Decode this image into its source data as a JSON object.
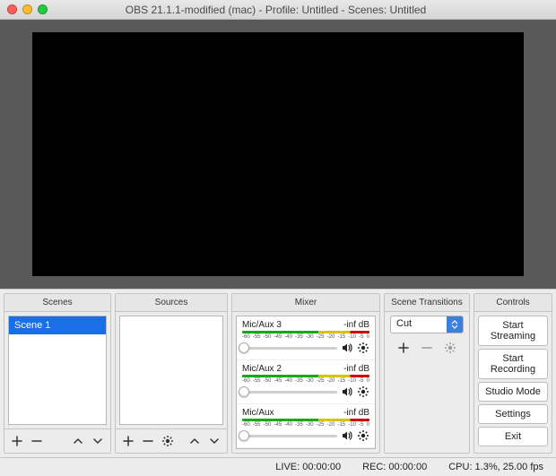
{
  "titlebar": {
    "title": "OBS 21.1.1-modified (mac) - Profile: Untitled - Scenes: Untitled"
  },
  "panels": {
    "scenes": {
      "header": "Scenes",
      "items": [
        "Scene 1"
      ]
    },
    "sources": {
      "header": "Sources"
    },
    "mixer": {
      "header": "Mixer",
      "ticks": [
        "-60",
        "-55",
        "-50",
        "-45",
        "-40",
        "-35",
        "-30",
        "-25",
        "-20",
        "-15",
        "-10",
        "-5",
        "0"
      ],
      "channels": [
        {
          "name": "Mic/Aux 3",
          "level": "-inf dB"
        },
        {
          "name": "Mic/Aux 2",
          "level": "-inf dB"
        },
        {
          "name": "Mic/Aux",
          "level": "-inf dB"
        }
      ]
    },
    "transitions": {
      "header": "Scene Transitions",
      "selected": "Cut"
    },
    "controls": {
      "header": "Controls",
      "buttons": {
        "start_streaming": "Start Streaming",
        "start_recording": "Start Recording",
        "studio_mode": "Studio Mode",
        "settings": "Settings",
        "exit": "Exit"
      }
    }
  },
  "status": {
    "live": "LIVE: 00:00:00",
    "rec": "REC: 00:00:00",
    "cpu": "CPU: 1.3%, 25.00 fps"
  }
}
